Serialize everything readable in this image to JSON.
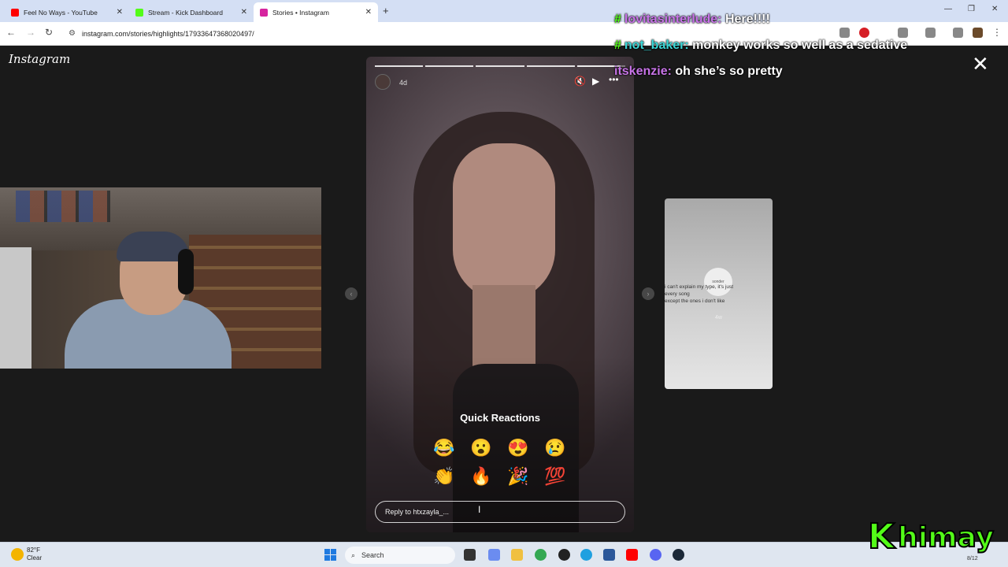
{
  "browser": {
    "tabs": [
      {
        "title": "Feel No Ways - YouTube",
        "favicon_color": "#ff0000"
      },
      {
        "title": "Stream - Kick Dashboard",
        "favicon_color": "#53fc18"
      },
      {
        "title": "Stories • Instagram",
        "favicon_color": "#d6249f"
      }
    ],
    "new_tab": "+",
    "tab_close": "✕",
    "window_controls": [
      "—",
      "❐",
      "✕"
    ],
    "url": "instagram.com/stories/highlights/17933647368020497/",
    "nav": {
      "back": "←",
      "forward": "→",
      "reload": "↻"
    }
  },
  "instagram": {
    "logo": "Instagram",
    "close": "✕",
    "story": {
      "age": "4d",
      "progress_segments": 5,
      "controls": {
        "mute": "🔇",
        "play": "▶",
        "more": "•••"
      },
      "quick_reactions_title": "Quick Reactions",
      "reactions": [
        "😂",
        "😮",
        "😍",
        "😢",
        "👏",
        "🔥",
        "🎉",
        "💯"
      ],
      "reply_placeholder": "Reply to htxzayla_..."
    },
    "arrows": {
      "prev": "‹",
      "next": "›"
    },
    "next_story": {
      "avatar_label": "sonder",
      "text": "i can't explain my type, it's just\nevery song\nexcept the ones i don't like",
      "age": "4w"
    }
  },
  "chat": [
    {
      "user": "lovitasinterlude:",
      "message": "Here!!!!",
      "user_color": "#c874e8"
    },
    {
      "user": "not_baker:",
      "message": "monkey works so well as a sedative",
      "user_color": "#3ad6d6"
    },
    {
      "user": "itskenzie:",
      "message": "oh she’s so pretty",
      "user_color": "#c874e8"
    }
  ],
  "chat_badge": "#",
  "taskbar": {
    "weather_temp": "82°F",
    "weather_cond": "Clear",
    "search_label": "Search",
    "clock_date": "8/12"
  },
  "stream_logo": {
    "k": "K",
    "name": "himay"
  }
}
